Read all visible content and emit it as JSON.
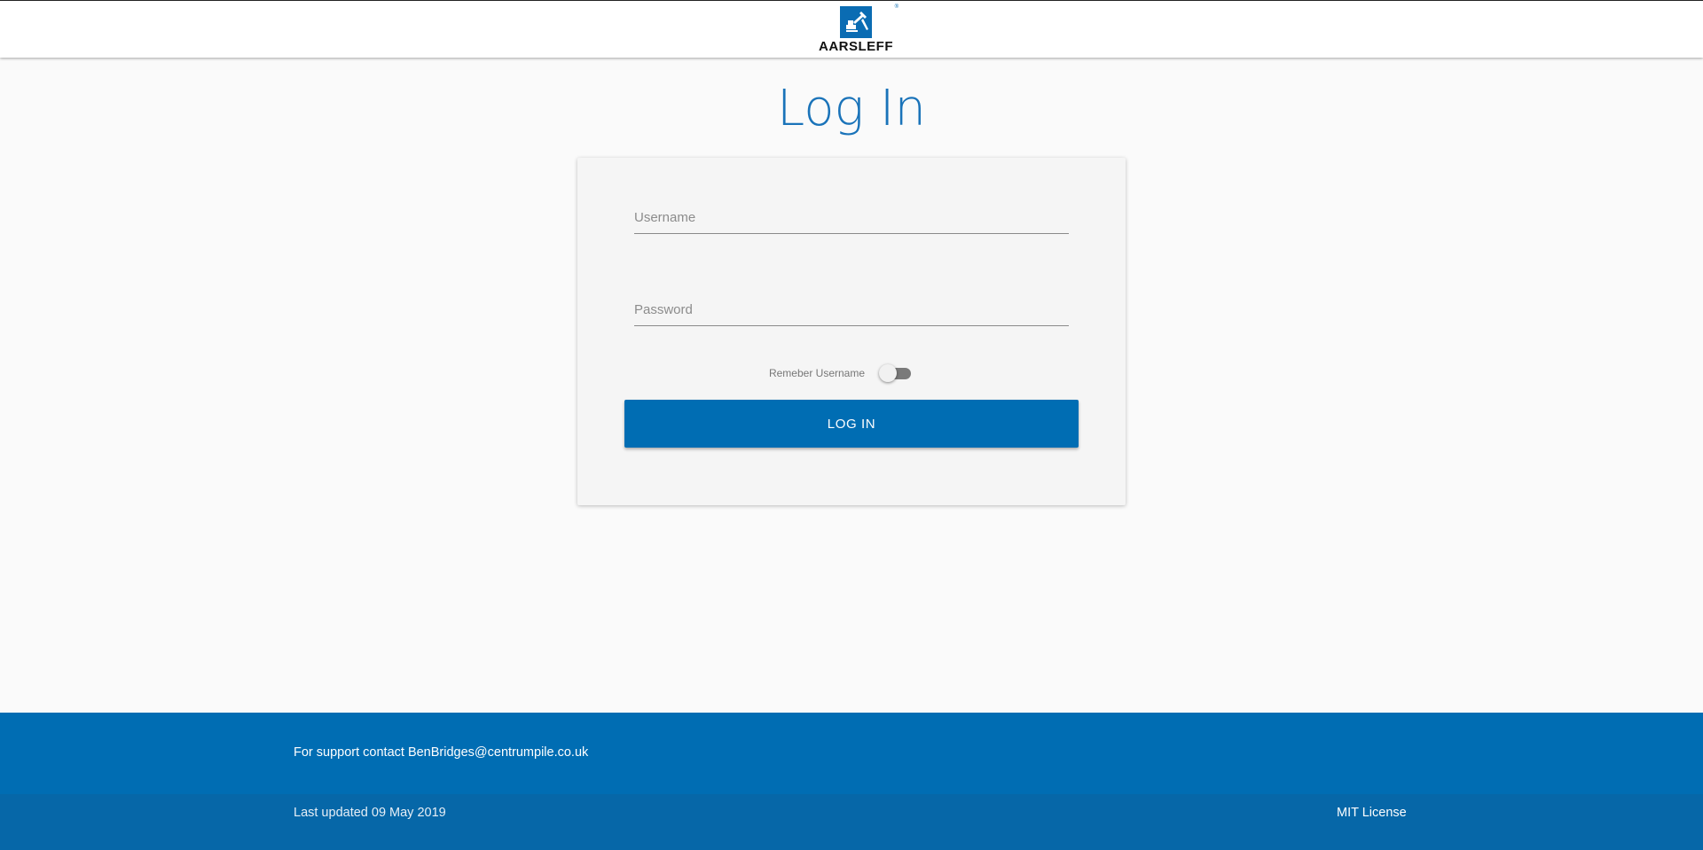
{
  "header": {
    "logo_text": "AARSLEFF",
    "logo_mark": "®"
  },
  "main": {
    "title": "Log In",
    "form": {
      "username": {
        "placeholder": "Username",
        "value": ""
      },
      "password": {
        "placeholder": "Password",
        "value": ""
      },
      "remember_label": "Remeber Username",
      "remember_checked": false,
      "submit_label": "LOG IN"
    }
  },
  "footer": {
    "support": "For support contact BenBridges@centrumpile.co.uk",
    "last_updated": "Last updated 09 May 2019",
    "license": "MIT License"
  },
  "colors": {
    "accent": "#006db3",
    "title": "#1a73b9",
    "background": "#fafafa",
    "card": "#f5f5f5"
  },
  "icons": {
    "logo": "aarsleff-logo-icon",
    "toggle": "toggle-switch-icon"
  }
}
